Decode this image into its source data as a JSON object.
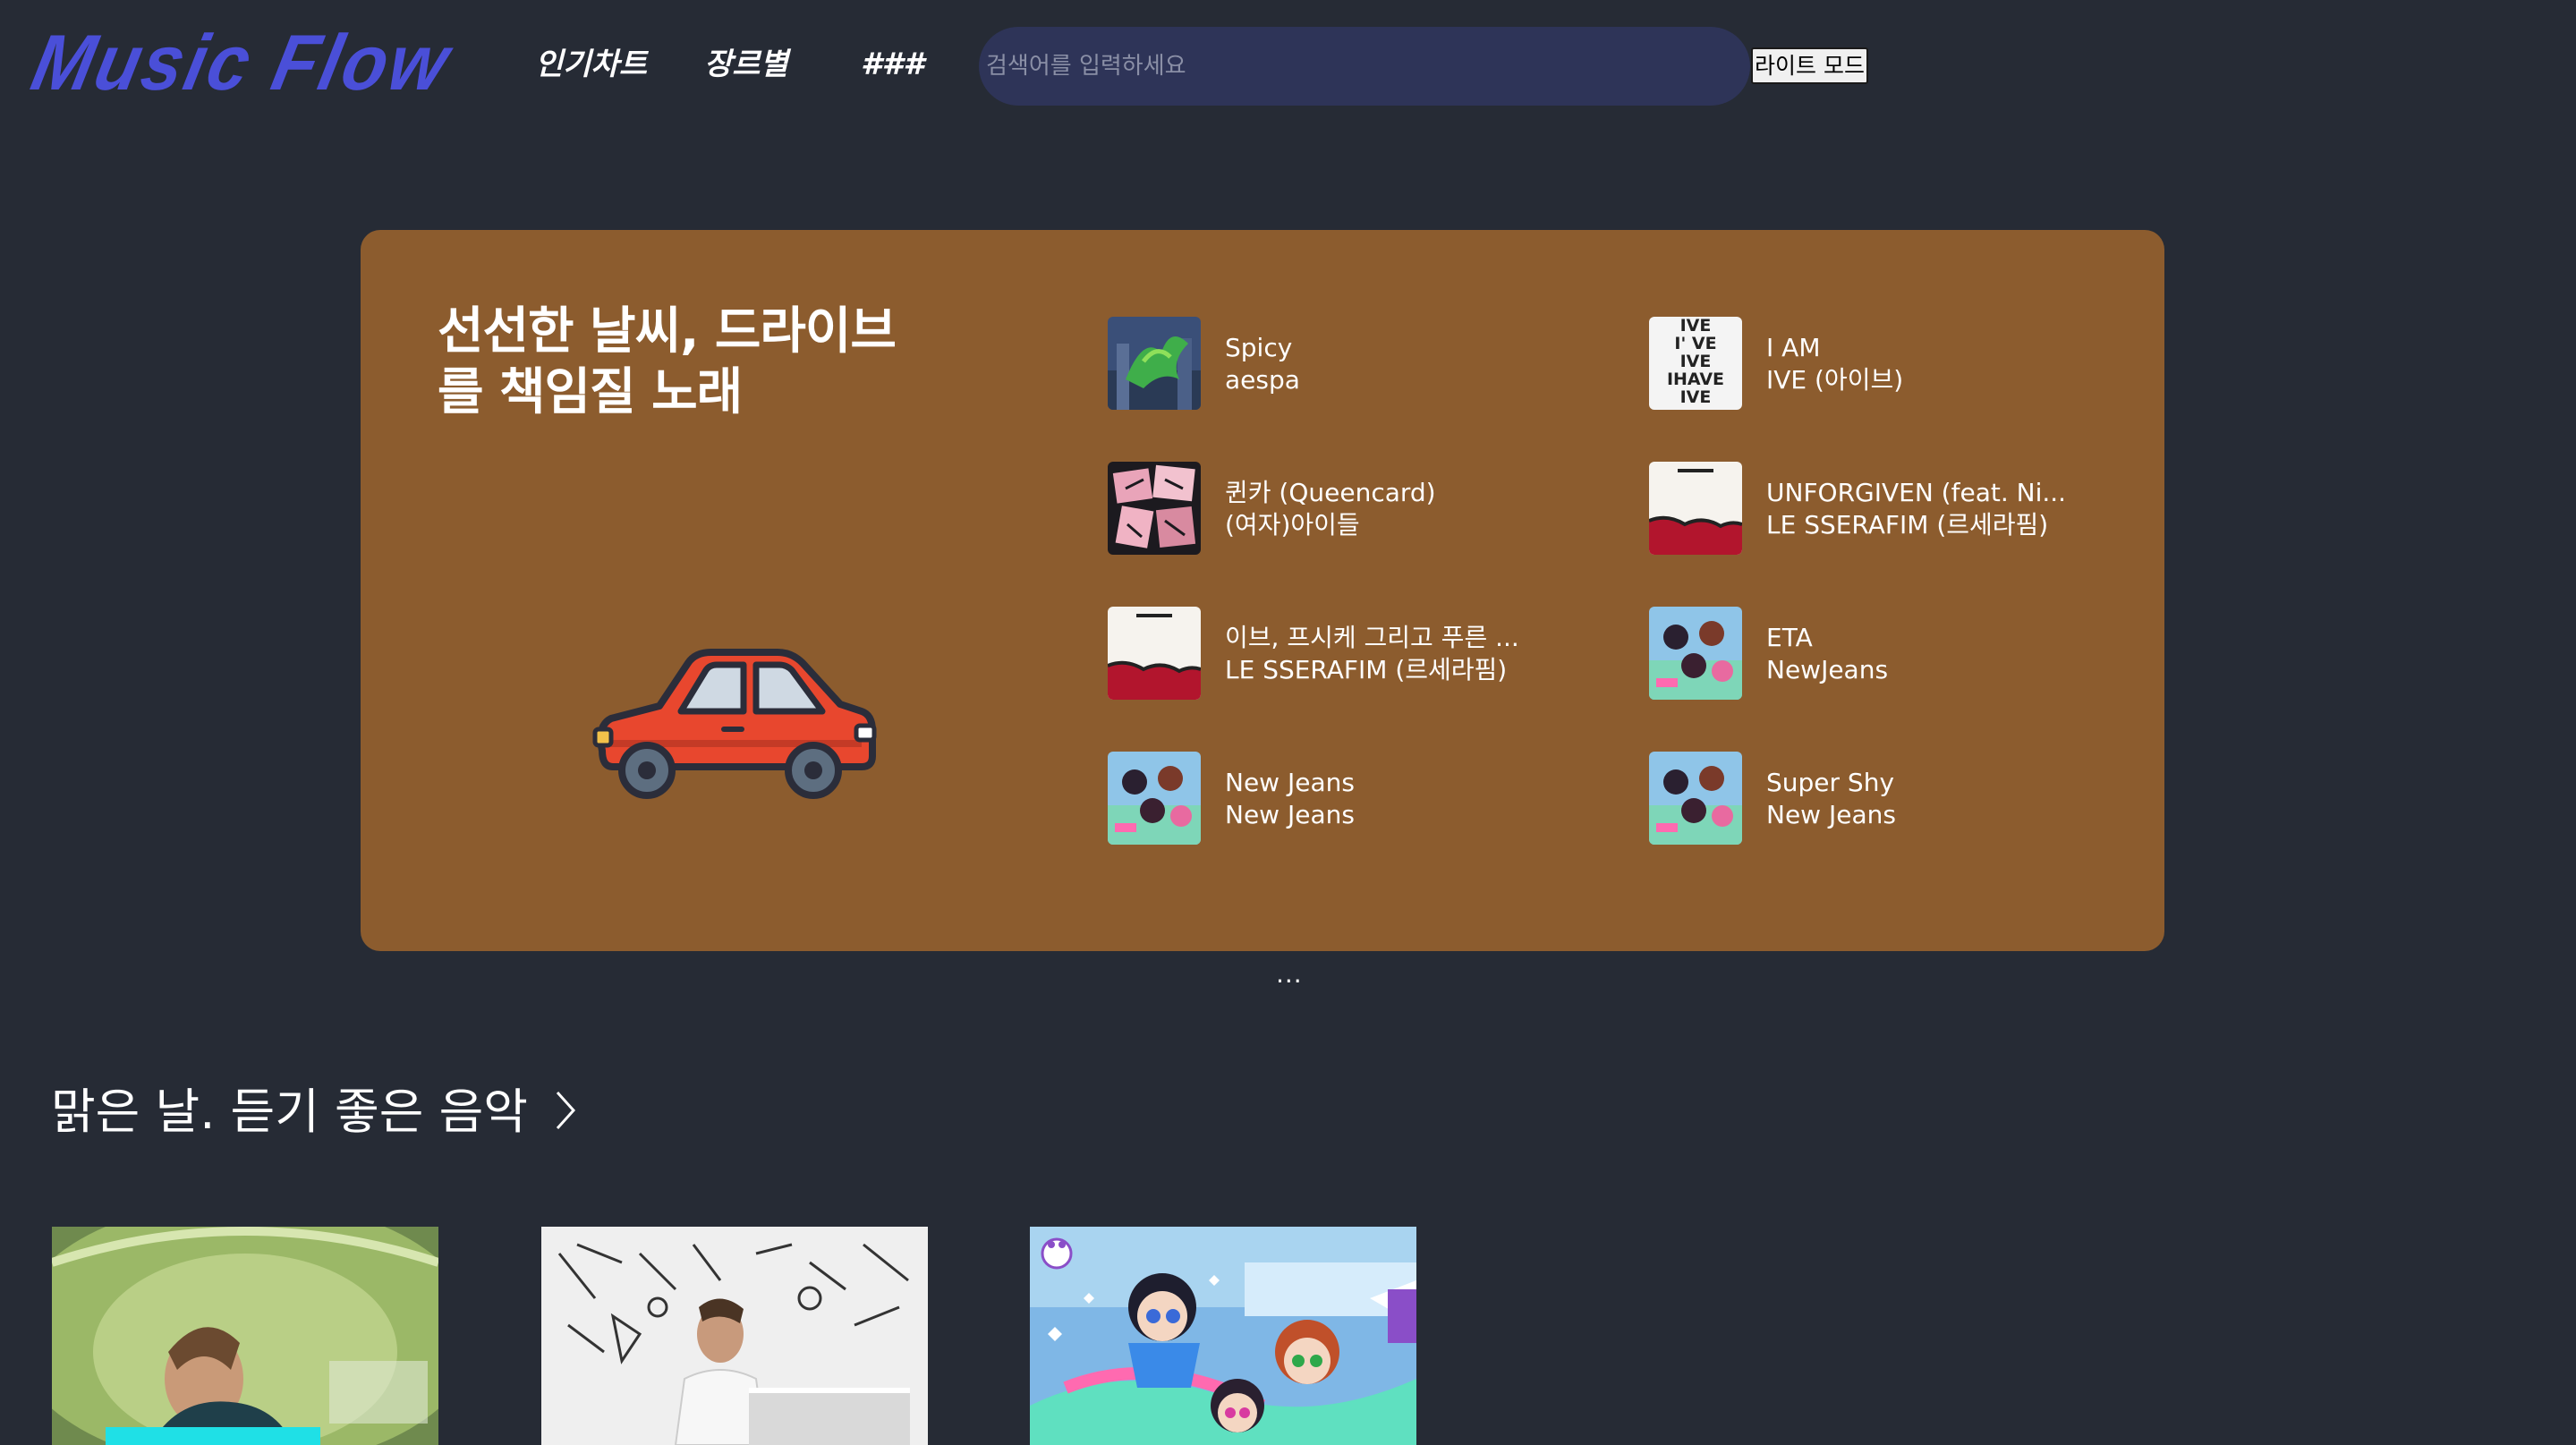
{
  "header": {
    "logo": "Music Flow",
    "nav": [
      "인기차트",
      "장르별",
      "###"
    ],
    "search_placeholder": "검색어를 입력하세요",
    "mode_button": "라이트 모드"
  },
  "featured": {
    "title_line1": "선선한 날씨, 드라이브",
    "title_line2": "를 책임질 노래",
    "illustration": "car-icon",
    "background": "#8c5c2e",
    "tracks": [
      {
        "title": "Spicy",
        "artist": "aespa"
      },
      {
        "title": "I AM",
        "artist": "IVE (아이브)"
      },
      {
        "title": "퀸카 (Queencard)",
        "artist": "(여자)아이들"
      },
      {
        "title": "UNFORGIVEN (feat. Ni...",
        "artist": "LE SSERAFIM (르세라핌)"
      },
      {
        "title": "이브, 프시케 그리고 푸른 ...",
        "artist": "LE SSERAFIM (르세라핌)"
      },
      {
        "title": "ETA",
        "artist": "NewJeans"
      },
      {
        "title": "New Jeans",
        "artist": "New Jeans"
      },
      {
        "title": "Super Shy",
        "artist": "New Jeans"
      }
    ],
    "pager": "..."
  },
  "section": {
    "title": "맑은 날. 듣기 좋은 음악",
    "chevron": "chevron-right-icon"
  },
  "colors": {
    "background": "#262b35",
    "logo": "#4a4fd8",
    "search_bg": "#2e3458"
  }
}
